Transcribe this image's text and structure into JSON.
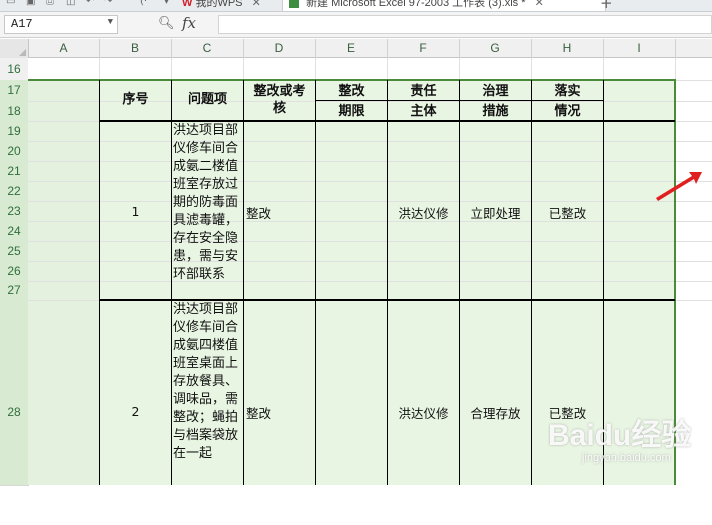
{
  "tabs": [
    {
      "label": "我的WPS",
      "logo": "W"
    },
    {
      "label": "新建 Microsoft Excel 97-2003 工作表 (3).xls *"
    }
  ],
  "name_box": "A17",
  "formula_label": "fx",
  "columns": [
    "A",
    "B",
    "C",
    "D",
    "E",
    "F",
    "G",
    "H",
    "I"
  ],
  "rows": [
    "16",
    "17",
    "18",
    "19",
    "20",
    "21",
    "22",
    "23",
    "24",
    "25",
    "26",
    "27",
    "28"
  ],
  "headers": {
    "seq": "序号",
    "issue": "问题项",
    "rect1": "整改或考",
    "rect2": "核",
    "deadline1": "整改",
    "deadline2": "期限",
    "resp1": "责任",
    "resp2": "主体",
    "measure1": "治理",
    "measure2": "措施",
    "status1": "落实",
    "status2": "情况"
  },
  "records": [
    {
      "seq": "1",
      "issue": "洪达项目部仪修车间合成氨二楼值班室存放过期的防毒面具滤毒罐，存在安全隐患，需与安环部联系",
      "rect": "整改",
      "resp": "洪达仪修",
      "measure": "立即处理",
      "status": "已整改"
    },
    {
      "seq": "2",
      "issue": "洪达项目部仪修车间合成氨四楼值班室桌面上存放餐具、调味品，需整改；蝇拍与档案袋放在一起",
      "rect": "整改",
      "resp": "洪达仪修",
      "measure": "合理存放",
      "status": "已整改"
    }
  ],
  "watermark": {
    "brand": "Baidu经验",
    "url": "jingyan.baidu.com"
  },
  "colors": {
    "header_green": "#e9f5e3",
    "grid_line": "#e0e0e0",
    "border": "#000000",
    "arrow": "#e02020"
  }
}
